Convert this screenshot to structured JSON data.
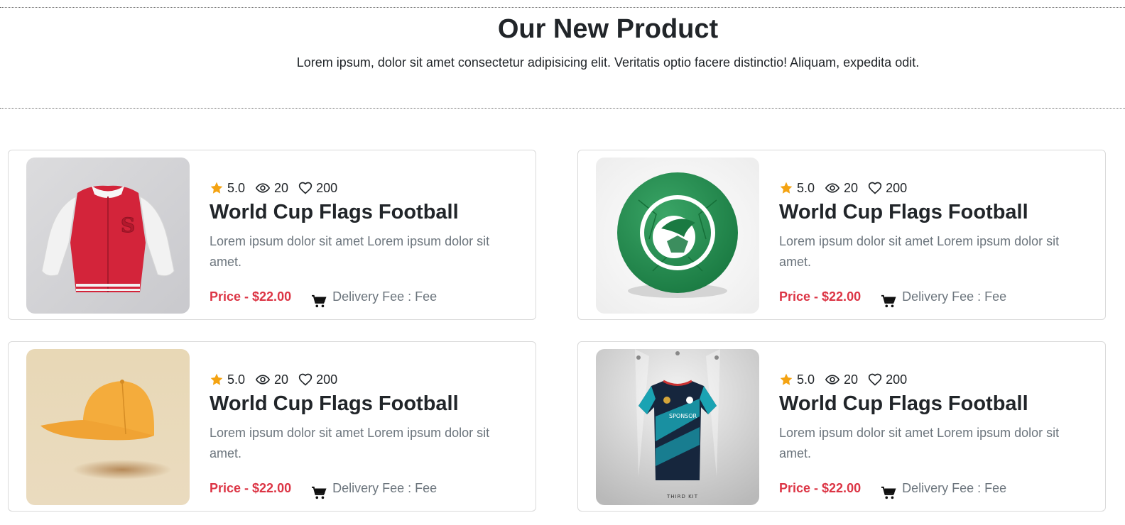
{
  "section": {
    "title": "Our New Product",
    "subtitle": "Lorem ipsum, dolor sit amet consectetur adipisicing elit. Veritatis optio facere distinctio! Aliquam, expedita odit."
  },
  "colors": {
    "accent_price": "#dc3545",
    "star": "#f4a312",
    "muted_text": "#6c757d"
  },
  "products": [
    {
      "image": "red-varsity-jacket",
      "rating": "5.0",
      "views": "20",
      "likes": "200",
      "title": "World Cup Flags Football",
      "description": "Lorem ipsum dolor sit amet Lorem ipsum dolor sit amet.",
      "price": "Price - $22.00",
      "delivery": "Delivery Fee : Fee"
    },
    {
      "image": "green-football-ball",
      "rating": "5.0",
      "views": "20",
      "likes": "200",
      "title": "World Cup Flags Football",
      "description": "Lorem ipsum dolor sit amet Lorem ipsum dolor sit amet.",
      "price": "Price - $22.00",
      "delivery": "Delivery Fee : Fee"
    },
    {
      "image": "orange-baseball-cap",
      "rating": "5.0",
      "views": "20",
      "likes": "200",
      "title": "World Cup Flags Football",
      "description": "Lorem ipsum dolor sit amet Lorem ipsum dolor sit amet.",
      "price": "Price - $22.00",
      "delivery": "Delivery Fee : Fee"
    },
    {
      "image": "teal-football-jersey",
      "image_text": "THIRD KIT",
      "rating": "5.0",
      "views": "20",
      "likes": "200",
      "title": "World Cup Flags Football",
      "description": "Lorem ipsum dolor sit amet Lorem ipsum dolor sit amet.",
      "price": "Price - $22.00",
      "delivery": "Delivery Fee : Fee"
    }
  ]
}
